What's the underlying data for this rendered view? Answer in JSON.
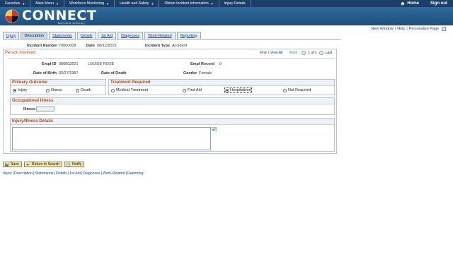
{
  "topnav": {
    "items": [
      "Favorites",
      "Main Menu",
      "Workforce Monitoring",
      "Health and Safety",
      "Obtain Incident Information",
      "Injury Details"
    ],
    "home": "Home",
    "signout": "Sign out"
  },
  "brand": {
    "name": "CONNECT",
    "sub": "Maryland Judiciary"
  },
  "util": {
    "new_window": "New Window",
    "help": "Help",
    "personalize": "Personalize Page"
  },
  "tabs": [
    "Injury",
    "Description",
    "Statements",
    "Details",
    "1st Aid",
    "Diagnoses",
    "Work-Related",
    "Reporting"
  ],
  "active_tab": "Description",
  "header": {
    "incident_number_label": "Incident Number",
    "incident_number": "70000009",
    "date_label": "Date",
    "date": "08/12/2015",
    "incident_type_label": "Incident Type",
    "incident_type": "Accident"
  },
  "panel": {
    "title": "Person Involved",
    "find": "Find",
    "view_all": "View All",
    "first": "First",
    "count": "1 of 1",
    "last": "Last"
  },
  "person": {
    "empl_id_label": "Empl ID",
    "empl_id": "000002521",
    "name": "LOUISE ROSE",
    "empl_record_label": "Empl Record",
    "empl_record": "0",
    "dob_label": "Date of Birth",
    "dob": "03/27/1957",
    "dod_label": "Date of Death",
    "gender_label": "Gender",
    "gender": "Female"
  },
  "primary_outcome": {
    "title": "Primary Outcome",
    "options": [
      "Injury",
      "Illness",
      "Death"
    ],
    "selected": "Injury"
  },
  "treatment": {
    "title": "Treatment Required",
    "options": [
      "Medical Treatment",
      "First Aid",
      "Hospitalized",
      "Not Required"
    ],
    "selected": "Hospitalized"
  },
  "occupational": {
    "title": "Occupational Illness",
    "illness_label": "Illness",
    "illness_value": ""
  },
  "details": {
    "title": "Injury/Illness Details",
    "text": ""
  },
  "buttons": {
    "save": "Save",
    "return": "Return to Search",
    "notify": "Notify"
  },
  "footer_links": [
    "Injury",
    "Description",
    "Statements",
    "Details",
    "1st Aid",
    "Diagnoses",
    "Work-Related",
    "Reporting"
  ]
}
